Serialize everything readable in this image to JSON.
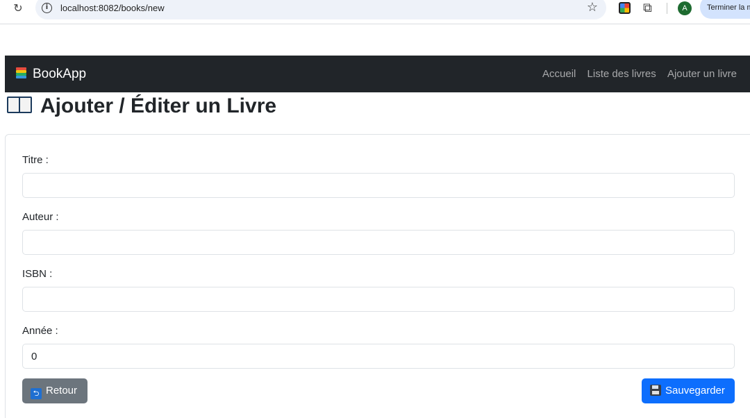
{
  "browser": {
    "url": "localhost:8082/books/new",
    "profile_initial": "A",
    "side_button": "Terminer la mise à jour"
  },
  "navbar": {
    "brand": "BookApp",
    "links": [
      "Accueil",
      "Liste des livres",
      "Ajouter un livre"
    ]
  },
  "page": {
    "title": "Ajouter / Éditer un Livre"
  },
  "form": {
    "fields": [
      {
        "label": "Titre :",
        "value": ""
      },
      {
        "label": "Auteur :",
        "value": ""
      },
      {
        "label": "ISBN :",
        "value": ""
      },
      {
        "label": "Année :",
        "value": "0"
      }
    ],
    "back_button": "Retour",
    "save_button": "Sauvegarder"
  },
  "colors": {
    "navbar": "#212529",
    "primary": "#0d6efd",
    "secondary": "#6c757d"
  },
  "icons": [
    "reload-icon",
    "info-icon",
    "star-icon",
    "extension-icon",
    "puzzle-icon",
    "books-icon",
    "open-book-icon",
    "return-icon",
    "floppy-disk-icon"
  ]
}
